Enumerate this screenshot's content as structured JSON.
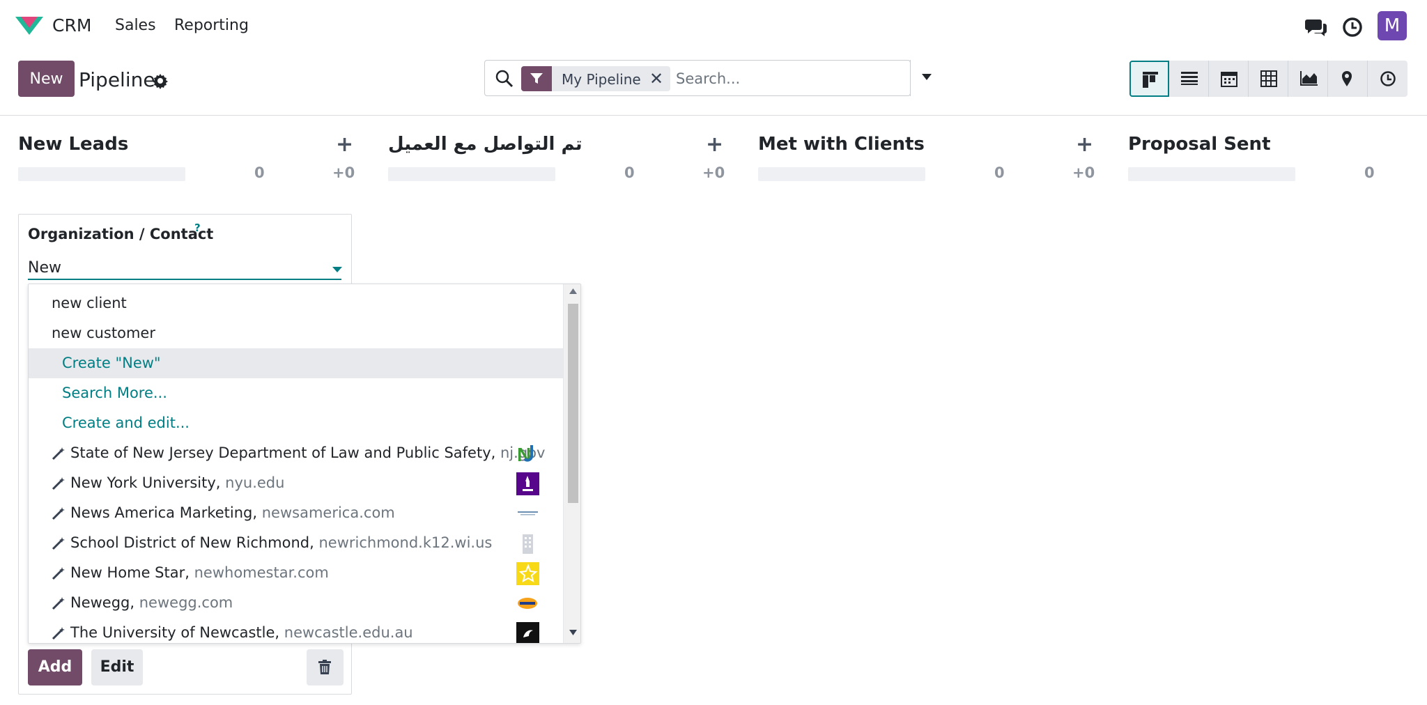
{
  "topnav": {
    "app_name": "CRM",
    "menus": [
      "Sales",
      "Reporting"
    ],
    "avatar_initial": "M",
    "avatar_color": "#6e47b0"
  },
  "control": {
    "new_label": "New",
    "title": "Pipeline",
    "facet_label": "My Pipeline",
    "facet_close": "✕",
    "search_placeholder": "Search...",
    "views": [
      "kanban-icon",
      "list-icon",
      "calendar-icon",
      "pivot-icon",
      "graph-icon",
      "map-icon",
      "activity-icon"
    ],
    "active_view": "kanban-icon"
  },
  "kanban": {
    "columns": [
      {
        "title": "New Leads",
        "count": "0",
        "sum": "+0"
      },
      {
        "title": "تم التواصل مع العميل",
        "count": "0",
        "sum": "+0"
      },
      {
        "title": "Met with Clients",
        "count": "0",
        "sum": "+0"
      },
      {
        "title": "Proposal Sent",
        "count": "0"
      }
    ],
    "add_symbol": "+"
  },
  "quick_create": {
    "field_label": "Organization / Contact",
    "help_mark": "?",
    "input_value": "New",
    "add_label": "Add",
    "edit_label": "Edit"
  },
  "dropdown": {
    "records": [
      "new client",
      "new customer"
    ],
    "actions": [
      "Create \"New\"",
      "Search More...",
      "Create and edit..."
    ],
    "highlighted_action": "Create \"New\"",
    "companies": [
      {
        "name": "State of New Jersey Department of Law and Public Safety,",
        "domain": "nj.gov",
        "logo": "nj-logo"
      },
      {
        "name": "New York University,",
        "domain": "nyu.edu",
        "logo": "nyu-logo"
      },
      {
        "name": "News America Marketing,",
        "domain": "newsamerica.com",
        "logo": "newsamerica-logo"
      },
      {
        "name": "School District of New Richmond,",
        "domain": "newrichmond.k12.wi.us",
        "logo": "building-logo"
      },
      {
        "name": "New Home Star,",
        "domain": "newhomestar.com",
        "logo": "newhomestar-logo"
      },
      {
        "name": "Newegg,",
        "domain": "newegg.com",
        "logo": "newegg-logo"
      },
      {
        "name": "The University of Newcastle,",
        "domain": "newcastle.edu.au",
        "logo": "newcastle-logo"
      }
    ]
  },
  "colors": {
    "brand": "#714b67",
    "accent": "#017e84"
  }
}
